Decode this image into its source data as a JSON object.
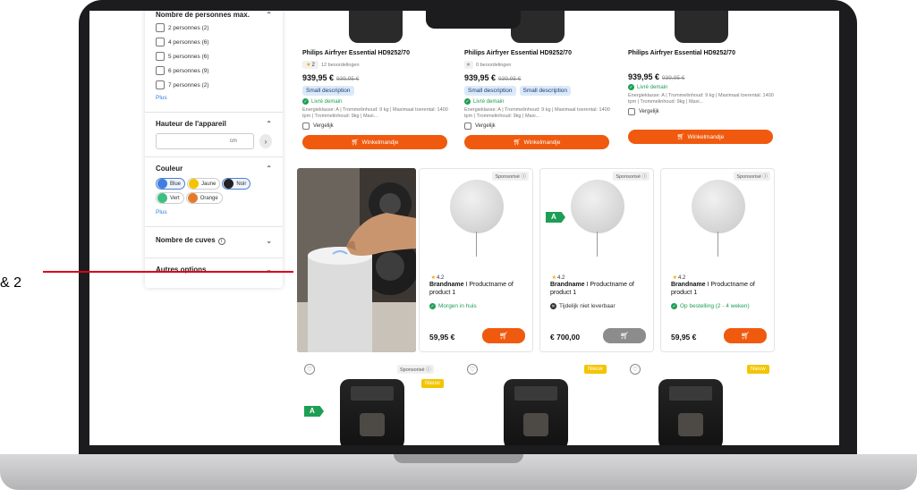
{
  "annotation": {
    "text": "& 2"
  },
  "sidebar": {
    "persons_heading": "Nombre de personnes max.",
    "persons": [
      "2 personnes (2)",
      "4 personnes (6)",
      "5 personnes (6)",
      "6 personnes (9)",
      "7 personnes (2)"
    ],
    "persons_more": "Plus",
    "height_heading": "Hauteur de l'appareil",
    "height_unit": "cm",
    "color_heading": "Couleur",
    "colors": [
      {
        "label": "Blue",
        "hex": "#3f7ee0",
        "selected": true
      },
      {
        "label": "Jaune",
        "hex": "#f3c400",
        "selected": false
      },
      {
        "label": "Noir",
        "hex": "#222222",
        "selected": true
      },
      {
        "label": "Vert",
        "hex": "#3fbf7f",
        "selected": false
      },
      {
        "label": "Orange",
        "hex": "#e57b2a",
        "selected": false
      }
    ],
    "color_more": "Plus",
    "tanks_heading": "Nombre de cuves",
    "other_heading": "Autres options"
  },
  "top_products": [
    {
      "name": "Philips Airfryer Essential HD9252/70",
      "rating": "2",
      "reviews": "12 beoordelingen",
      "price": "939,95 €",
      "old_price": "939,95 €",
      "badges": [
        "Small description"
      ],
      "delivery": "Livré demain",
      "specs": "Energieklasse: A | Trommelinhoud: 9 kg | Maximaal toerental: 1400 tpm | Trommelinhoud: 9kg | Maxi...",
      "compare": "Vergelijk",
      "cart": "Winkelmandje"
    },
    {
      "name": "Philips Airfryer Essential HD9252/70",
      "rating": "",
      "reviews": "0 beoordelingen",
      "price": "939,95 €",
      "old_price": "939,95 €",
      "badges": [
        "Small description",
        "Small description"
      ],
      "delivery": "Livré demain",
      "specs": "Energieklasse: A | Trommelinhoud: 9 kg | Maximaal toerental: 1400 tpm | Trommelinhoud: 9kg | Maxi...",
      "compare": "Vergelijk",
      "cart": "Winkelmandje"
    },
    {
      "name": "Philips Airfryer Essential HD9252/70",
      "rating": "",
      "reviews": "",
      "price": "939,95 €",
      "old_price": "939,95 €",
      "badges": [],
      "delivery": "Livré demain",
      "specs": "Energieklasse: A | Trommelinhoud: 9 kg | Maximaal toerental: 1400 tpm | Trommelinhoud: 9kg | Maxi...",
      "compare": "Vergelijk",
      "cart": "Winkelmandje"
    }
  ],
  "sponsored": [
    {
      "tag": "Sponsorisé",
      "energy": "",
      "rating": "4.2",
      "brand": "Brandname",
      "product": "Productname of product 1",
      "delivery": "Morgen in huis",
      "delivery_status": "ok",
      "price": "59,95 €",
      "cart_enabled": true
    },
    {
      "tag": "Sponsorisé",
      "energy": "A",
      "rating": "4.2",
      "brand": "Brandname",
      "product": "Productname of product 1",
      "delivery": "Tijdelijk niet leverbaar",
      "delivery_status": "unavailable",
      "price": "€ 700,00",
      "cart_enabled": false
    },
    {
      "tag": "Sponsorisé",
      "energy": "",
      "rating": "4.2",
      "brand": "Brandname",
      "product": "Productname of product 1",
      "delivery": "Op bestelling (2 - 4 weken)",
      "delivery_status": "ok",
      "price": "59,95 €",
      "cart_enabled": true
    }
  ],
  "bottom": {
    "sponsored_tag": "Sponsorisé",
    "new_tag": "Nieuw",
    "energy": "A"
  },
  "colors": {
    "accent": "#f05a0e",
    "success": "#1e9e55",
    "link": "#2b7fe0",
    "badge_bg": "#dbe9f9"
  }
}
